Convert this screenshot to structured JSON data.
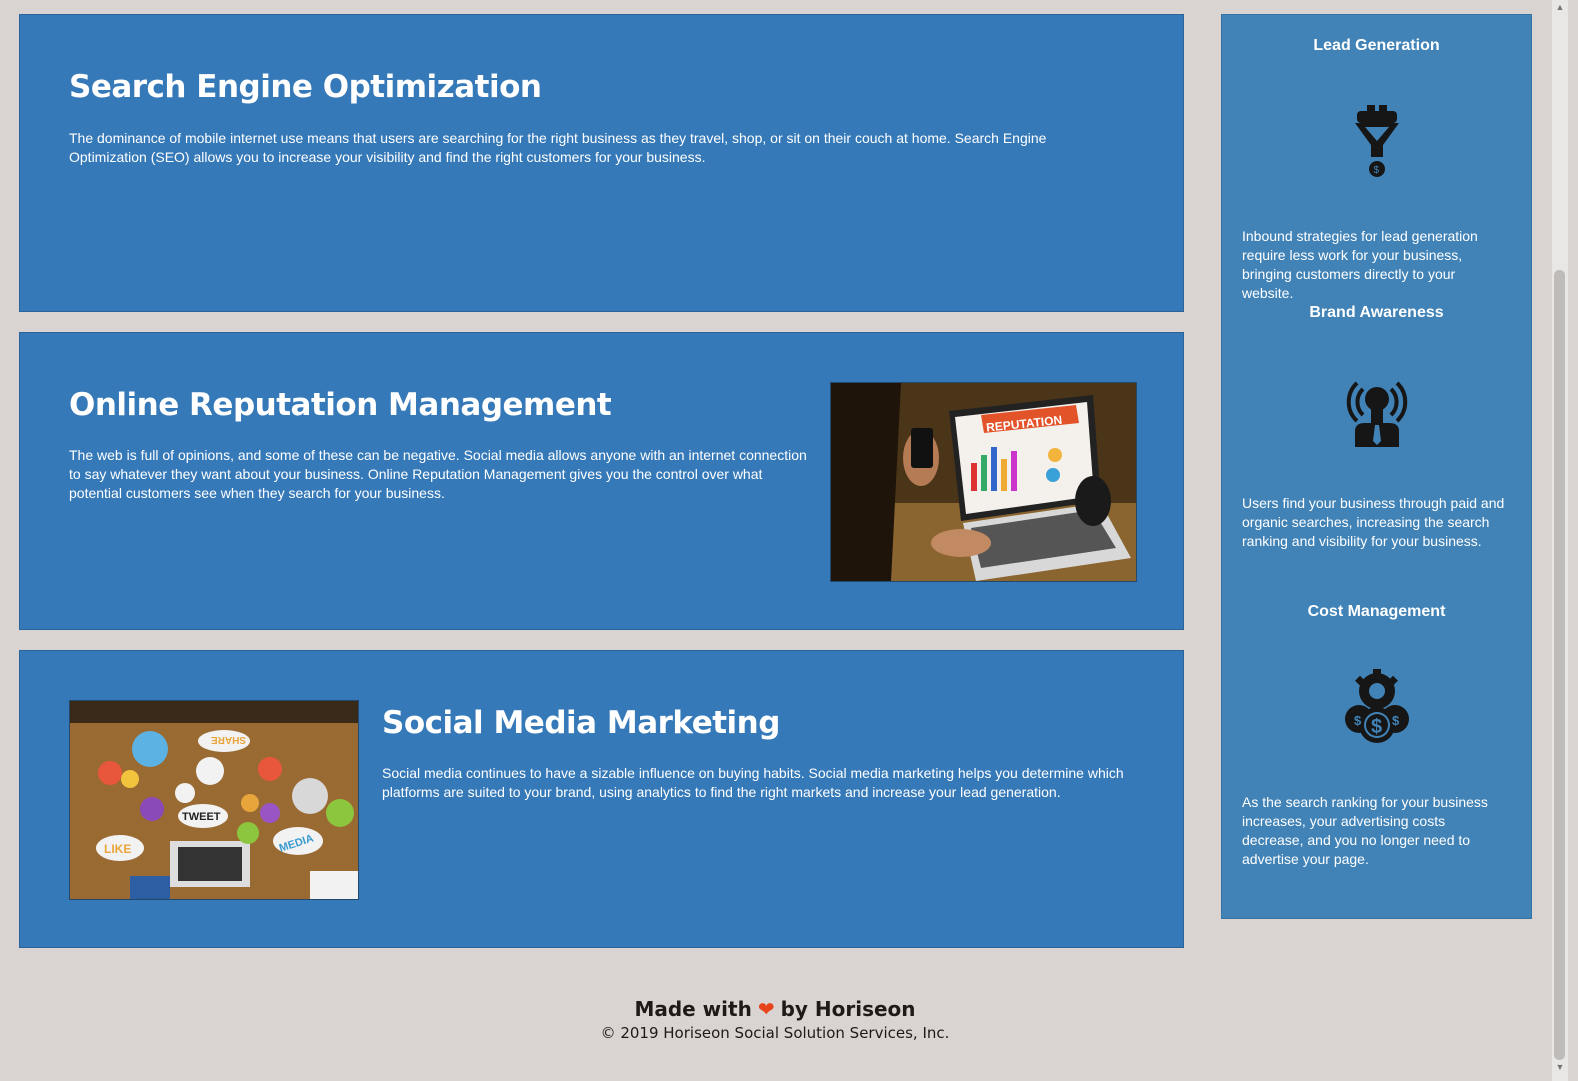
{
  "services": {
    "seo": {
      "title": "Search Engine Optimization",
      "text": "The dominance of mobile internet use means that users are searching for the right business as they travel, shop, or sit on their couch at home. Search Engine Optimization (SEO) allows you to increase your visibility and find the right customers for your business."
    },
    "orm": {
      "title": "Online Reputation Management",
      "text": "The web is full of opinions, and some of these can be negative. Social media allows anyone with an internet connection to say whatever they want about your business. Online Reputation Management gives you the control over what potential customers see when they search for your business.",
      "image_label": "REPUTATION"
    },
    "smm": {
      "title": "Social Media Marketing",
      "text": "Social media continues to have a sizable influence on buying habits. Social media marketing helps you determine which platforms are suited to your brand, using analytics to find the right markets and increase your lead generation.",
      "bubble_share": "SHARE",
      "bubble_tweet": "TWEET",
      "bubble_like": "LIKE",
      "bubble_media": "MEDIA"
    }
  },
  "benefits": {
    "lead": {
      "title": "Lead Generation",
      "text": "Inbound strategies for lead generation require less work for your business, bringing customers directly to your website."
    },
    "brand": {
      "title": "Brand Awareness",
      "text": "Users find your business through paid and organic searches, increasing the search ranking and visibility for your business."
    },
    "cost": {
      "title": "Cost Management",
      "text": "As the search ranking for your business increases, your advertising costs decrease, and you no longer need to advertise your page."
    }
  },
  "footer": {
    "made_prefix": "Made with",
    "made_suffix": "by Horiseon",
    "heart": "❤",
    "copyright": "© 2019 Horiseon Social Solution Services, Inc."
  },
  "colors": {
    "card": "#3579b8",
    "sidebar": "#4183b7",
    "background": "#d9d4d1",
    "heart": "#e8441b"
  },
  "icons": [
    "funnel-icon",
    "lightbulb-icon",
    "money-gear-icon"
  ]
}
